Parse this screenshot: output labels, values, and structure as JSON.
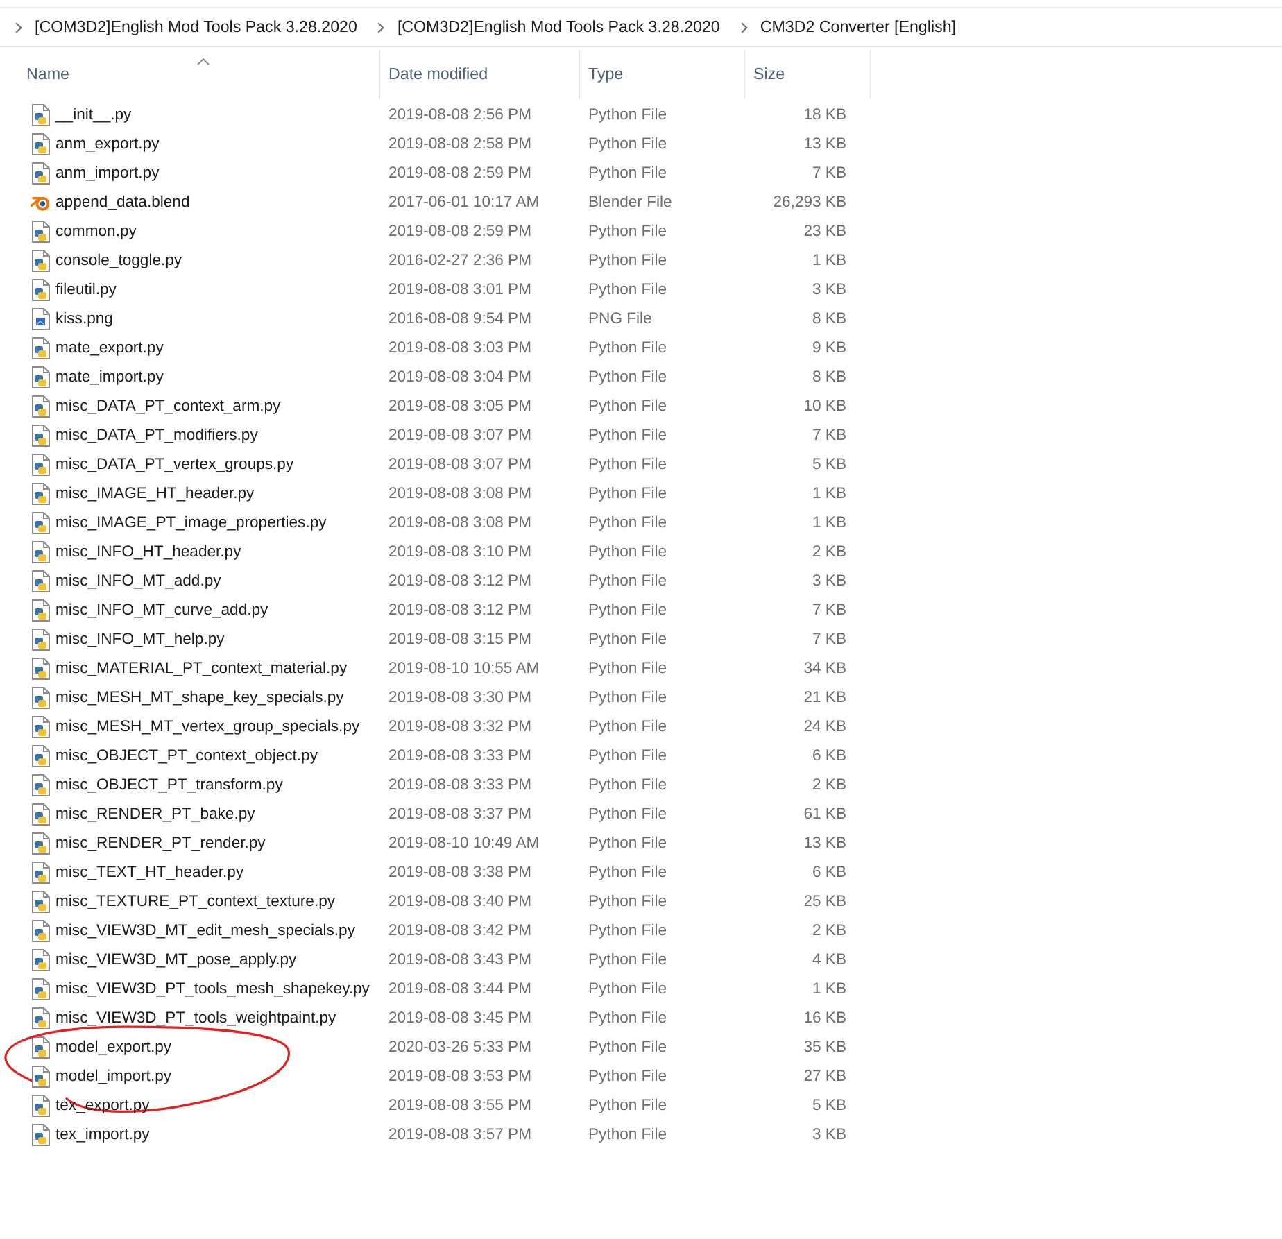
{
  "breadcrumb": [
    "[COM3D2]English Mod Tools Pack 3.28.2020",
    "[COM3D2]English Mod Tools Pack 3.28.2020",
    "CM3D2 Converter [English]"
  ],
  "table": {
    "columns": [
      {
        "label": "Name",
        "sorted": true
      },
      {
        "label": "Date modified",
        "sorted": false
      },
      {
        "label": "Type",
        "sorted": false
      },
      {
        "label": "Size",
        "sorted": false
      }
    ],
    "rows": [
      {
        "kind": "python",
        "name": "__init__.py",
        "date_modified": "2019-08-08 2:56 PM",
        "type": "Python File",
        "size": "18 KB",
        "circled": false
      },
      {
        "kind": "python",
        "name": "anm_export.py",
        "date_modified": "2019-08-08 2:58 PM",
        "type": "Python File",
        "size": "13 KB",
        "circled": false
      },
      {
        "kind": "python",
        "name": "anm_import.py",
        "date_modified": "2019-08-08 2:59 PM",
        "type": "Python File",
        "size": "7 KB",
        "circled": false
      },
      {
        "kind": "blender",
        "name": "append_data.blend",
        "date_modified": "2017-06-01 10:17 AM",
        "type": "Blender File",
        "size": "26,293 KB",
        "circled": false
      },
      {
        "kind": "python",
        "name": "common.py",
        "date_modified": "2019-08-08 2:59 PM",
        "type": "Python File",
        "size": "23 KB",
        "circled": false
      },
      {
        "kind": "python",
        "name": "console_toggle.py",
        "date_modified": "2016-02-27 2:36 PM",
        "type": "Python File",
        "size": "1 KB",
        "circled": false
      },
      {
        "kind": "python",
        "name": "fileutil.py",
        "date_modified": "2019-08-08 3:01 PM",
        "type": "Python File",
        "size": "3 KB",
        "circled": false
      },
      {
        "kind": "image",
        "name": "kiss.png",
        "date_modified": "2016-08-08 9:54 PM",
        "type": "PNG File",
        "size": "8 KB",
        "circled": false
      },
      {
        "kind": "python",
        "name": "mate_export.py",
        "date_modified": "2019-08-08 3:03 PM",
        "type": "Python File",
        "size": "9 KB",
        "circled": false
      },
      {
        "kind": "python",
        "name": "mate_import.py",
        "date_modified": "2019-08-08 3:04 PM",
        "type": "Python File",
        "size": "8 KB",
        "circled": false
      },
      {
        "kind": "python",
        "name": "misc_DATA_PT_context_arm.py",
        "date_modified": "2019-08-08 3:05 PM",
        "type": "Python File",
        "size": "10 KB",
        "circled": false
      },
      {
        "kind": "python",
        "name": "misc_DATA_PT_modifiers.py",
        "date_modified": "2019-08-08 3:07 PM",
        "type": "Python File",
        "size": "7 KB",
        "circled": false
      },
      {
        "kind": "python",
        "name": "misc_DATA_PT_vertex_groups.py",
        "date_modified": "2019-08-08 3:07 PM",
        "type": "Python File",
        "size": "5 KB",
        "circled": false
      },
      {
        "kind": "python",
        "name": "misc_IMAGE_HT_header.py",
        "date_modified": "2019-08-08 3:08 PM",
        "type": "Python File",
        "size": "1 KB",
        "circled": false
      },
      {
        "kind": "python",
        "name": "misc_IMAGE_PT_image_properties.py",
        "date_modified": "2019-08-08 3:08 PM",
        "type": "Python File",
        "size": "1 KB",
        "circled": false
      },
      {
        "kind": "python",
        "name": "misc_INFO_HT_header.py",
        "date_modified": "2019-08-08 3:10 PM",
        "type": "Python File",
        "size": "2 KB",
        "circled": false
      },
      {
        "kind": "python",
        "name": "misc_INFO_MT_add.py",
        "date_modified": "2019-08-08 3:12 PM",
        "type": "Python File",
        "size": "3 KB",
        "circled": false
      },
      {
        "kind": "python",
        "name": "misc_INFO_MT_curve_add.py",
        "date_modified": "2019-08-08 3:12 PM",
        "type": "Python File",
        "size": "7 KB",
        "circled": false
      },
      {
        "kind": "python",
        "name": "misc_INFO_MT_help.py",
        "date_modified": "2019-08-08 3:15 PM",
        "type": "Python File",
        "size": "7 KB",
        "circled": false
      },
      {
        "kind": "python",
        "name": "misc_MATERIAL_PT_context_material.py",
        "date_modified": "2019-08-10 10:55 AM",
        "type": "Python File",
        "size": "34 KB",
        "circled": false
      },
      {
        "kind": "python",
        "name": "misc_MESH_MT_shape_key_specials.py",
        "date_modified": "2019-08-08 3:30 PM",
        "type": "Python File",
        "size": "21 KB",
        "circled": false
      },
      {
        "kind": "python",
        "name": "misc_MESH_MT_vertex_group_specials.py",
        "date_modified": "2019-08-08 3:32 PM",
        "type": "Python File",
        "size": "24 KB",
        "circled": false
      },
      {
        "kind": "python",
        "name": "misc_OBJECT_PT_context_object.py",
        "date_modified": "2019-08-08 3:33 PM",
        "type": "Python File",
        "size": "6 KB",
        "circled": false
      },
      {
        "kind": "python",
        "name": "misc_OBJECT_PT_transform.py",
        "date_modified": "2019-08-08 3:33 PM",
        "type": "Python File",
        "size": "2 KB",
        "circled": false
      },
      {
        "kind": "python",
        "name": "misc_RENDER_PT_bake.py",
        "date_modified": "2019-08-08 3:37 PM",
        "type": "Python File",
        "size": "61 KB",
        "circled": false
      },
      {
        "kind": "python",
        "name": "misc_RENDER_PT_render.py",
        "date_modified": "2019-08-10 10:49 AM",
        "type": "Python File",
        "size": "13 KB",
        "circled": false
      },
      {
        "kind": "python",
        "name": "misc_TEXT_HT_header.py",
        "date_modified": "2019-08-08 3:38 PM",
        "type": "Python File",
        "size": "6 KB",
        "circled": false
      },
      {
        "kind": "python",
        "name": "misc_TEXTURE_PT_context_texture.py",
        "date_modified": "2019-08-08 3:40 PM",
        "type": "Python File",
        "size": "25 KB",
        "circled": false
      },
      {
        "kind": "python",
        "name": "misc_VIEW3D_MT_edit_mesh_specials.py",
        "date_modified": "2019-08-08 3:42 PM",
        "type": "Python File",
        "size": "2 KB",
        "circled": false
      },
      {
        "kind": "python",
        "name": "misc_VIEW3D_MT_pose_apply.py",
        "date_modified": "2019-08-08 3:43 PM",
        "type": "Python File",
        "size": "4 KB",
        "circled": false
      },
      {
        "kind": "python",
        "name": "misc_VIEW3D_PT_tools_mesh_shapekey.py",
        "date_modified": "2019-08-08 3:44 PM",
        "type": "Python File",
        "size": "1 KB",
        "circled": false
      },
      {
        "kind": "python",
        "name": "misc_VIEW3D_PT_tools_weightpaint.py",
        "date_modified": "2019-08-08 3:45 PM",
        "type": "Python File",
        "size": "16 KB",
        "circled": false
      },
      {
        "kind": "python",
        "name": "model_export.py",
        "date_modified": "2020-03-26 5:33 PM",
        "type": "Python File",
        "size": "35 KB",
        "circled": true
      },
      {
        "kind": "python",
        "name": "model_import.py",
        "date_modified": "2019-08-08 3:53 PM",
        "type": "Python File",
        "size": "27 KB",
        "circled": true
      },
      {
        "kind": "python",
        "name": "tex_export.py",
        "date_modified": "2019-08-08 3:55 PM",
        "type": "Python File",
        "size": "5 KB",
        "circled": false
      },
      {
        "kind": "python",
        "name": "tex_import.py",
        "date_modified": "2019-08-08 3:57 PM",
        "type": "Python File",
        "size": "3 KB",
        "circled": false
      }
    ]
  }
}
